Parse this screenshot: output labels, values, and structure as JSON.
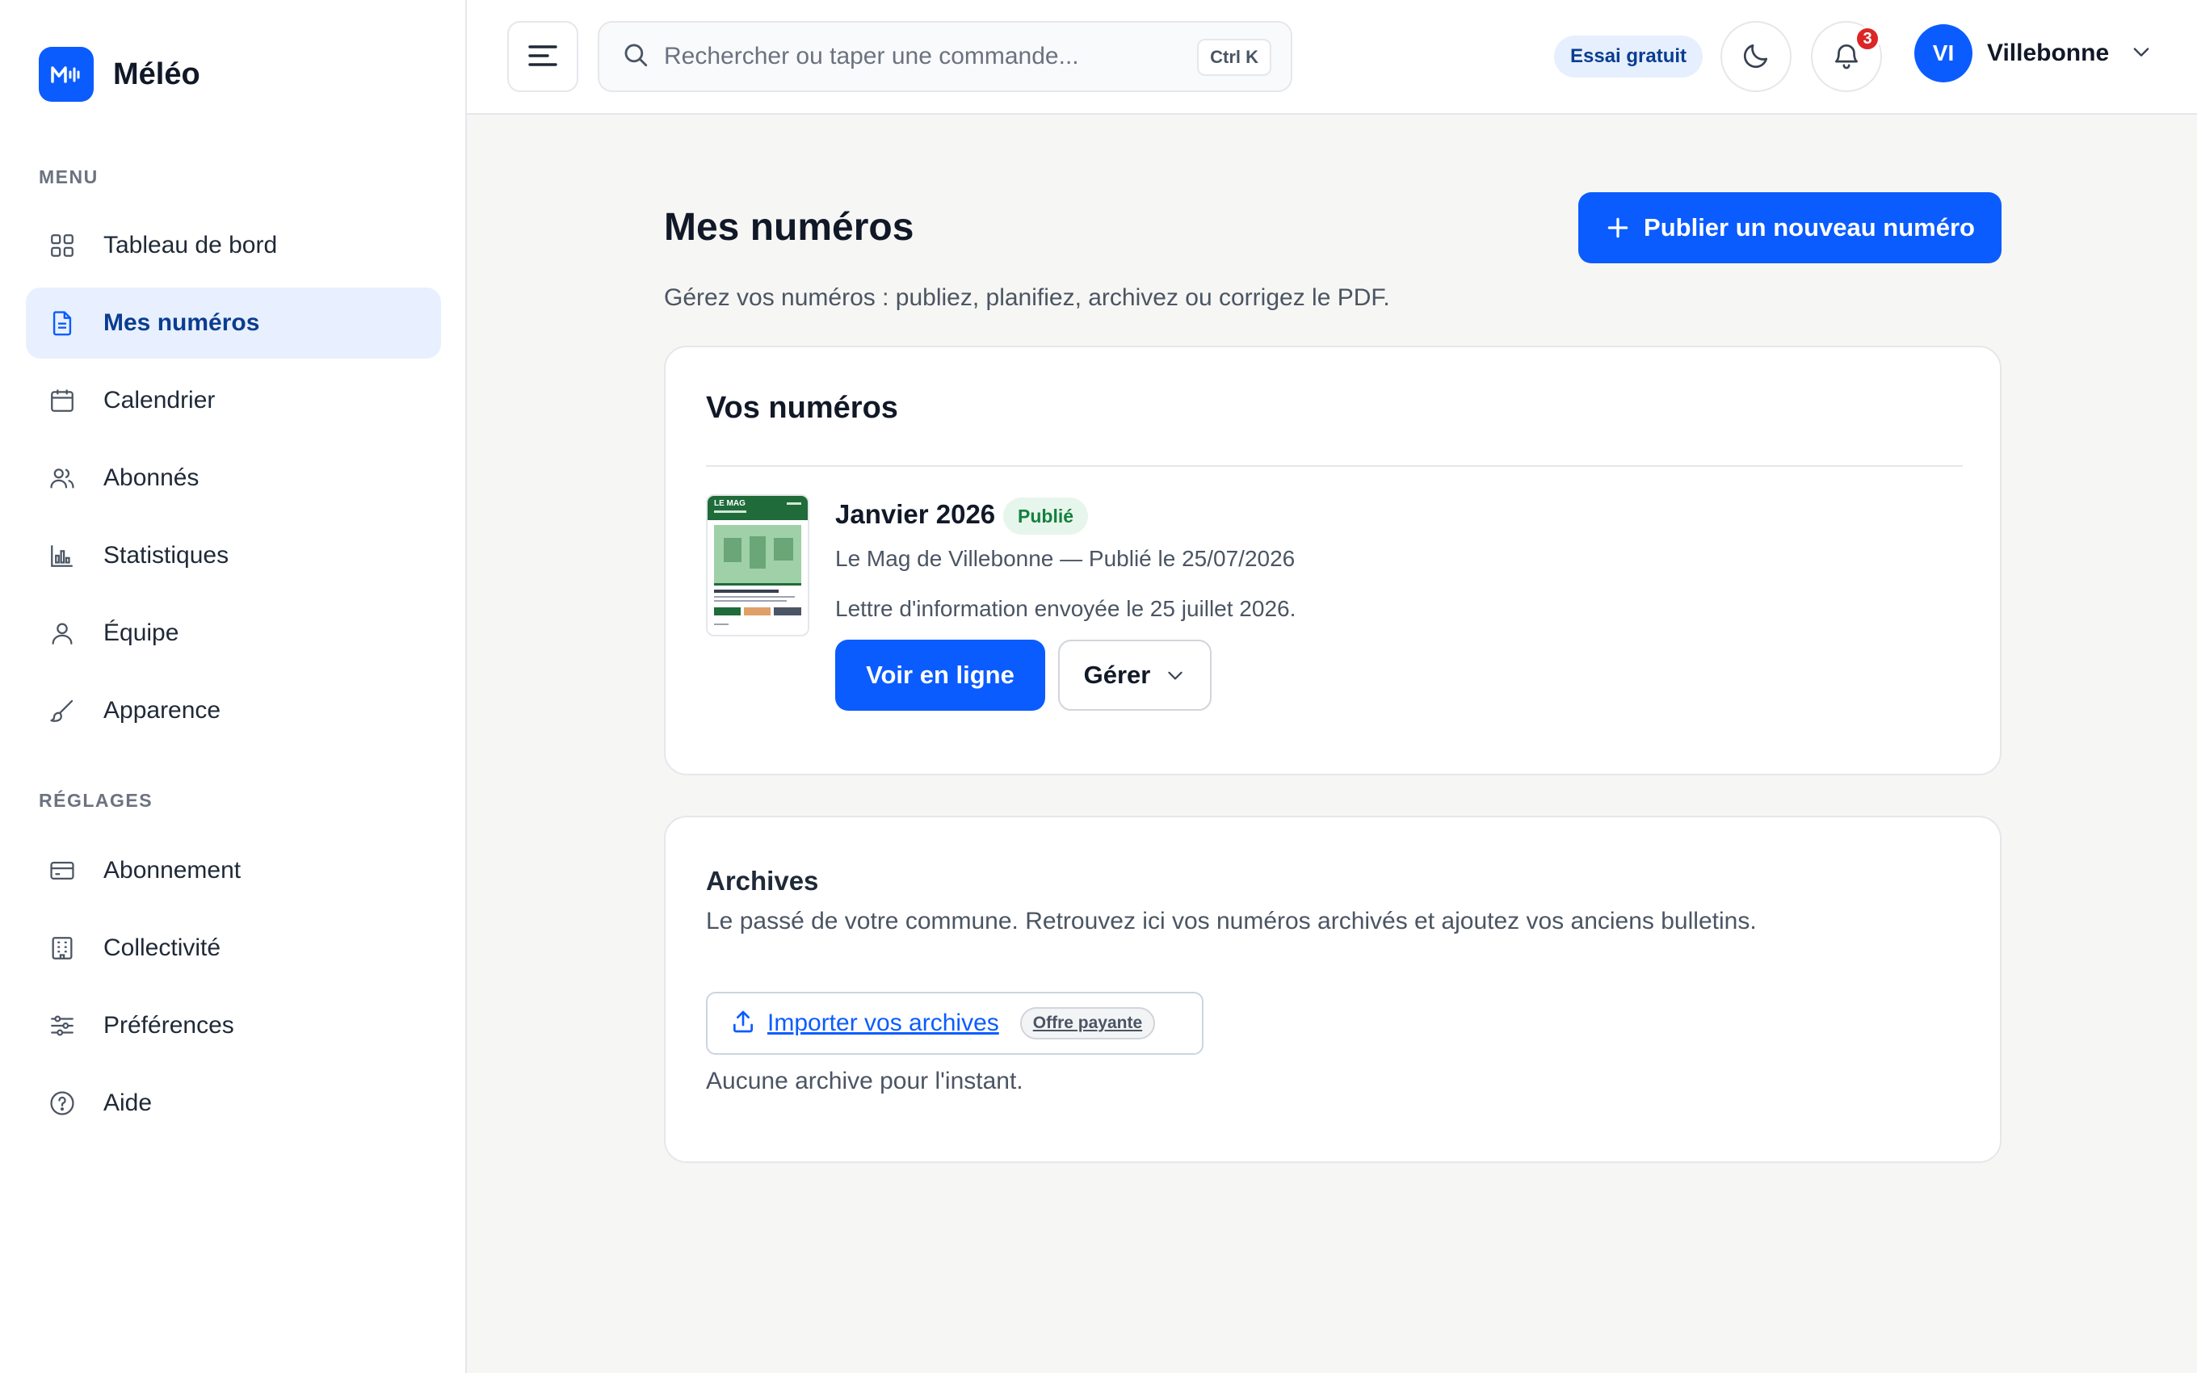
{
  "brand": {
    "name": "Méléo",
    "logo_text": "M"
  },
  "sidebar": {
    "menu_label": "MENU",
    "items": [
      {
        "label": "Tableau de bord",
        "icon": "grid-icon"
      },
      {
        "label": "Mes numéros",
        "icon": "document-icon",
        "active": true
      },
      {
        "label": "Calendrier",
        "icon": "calendar-icon"
      },
      {
        "label": "Abonnés",
        "icon": "users-icon"
      },
      {
        "label": "Statistiques",
        "icon": "bar-chart-icon"
      },
      {
        "label": "Équipe",
        "icon": "user-icon"
      },
      {
        "label": "Apparence",
        "icon": "brush-icon"
      }
    ],
    "settings_label": "RÉGLAGES",
    "settings_items": [
      {
        "label": "Abonnement",
        "icon": "credit-card-icon"
      },
      {
        "label": "Collectivité",
        "icon": "building-icon"
      },
      {
        "label": "Préférences",
        "icon": "sliders-icon"
      },
      {
        "label": "Aide",
        "icon": "help-circle-icon"
      }
    ]
  },
  "header": {
    "search_placeholder": "Rechercher ou taper une commande...",
    "search_shortcut": "Ctrl K",
    "trial_label": "Essai gratuit",
    "notification_count": "3",
    "user_initials": "VI",
    "user_name": "Villebonne"
  },
  "main": {
    "title": "Mes numéros",
    "subtitle": "Gérez vos numéros : publiez, planifiez, archivez ou corrigez le PDF.",
    "publish_button": "Publier un nouveau numéro",
    "issues_card": {
      "title": "Vos numéros",
      "issue": {
        "title": "Janvier 2026",
        "status": "Publié",
        "meta": "Le Mag de Villebonne — Publié le 25/07/2026",
        "note": "Lettre d'information envoyée le 25 juillet 2026.",
        "view_button": "Voir en ligne",
        "manage_button": "Gérer",
        "thumbnail_header": "LE MAG"
      }
    },
    "archives_card": {
      "title": "Archives",
      "description": "Le passé de votre commune. Retrouvez ici vos numéros archivés et ajoutez vos anciens bulletins.",
      "import_link": "Importer vos archives",
      "paid_badge": "Offre payante",
      "empty_text": "Aucune archive pour l'instant."
    }
  },
  "colors": {
    "accent": "#0b5cff",
    "active_nav_bg": "#e8f0ff",
    "success": "#15803d",
    "danger": "#dc2626",
    "page_bg": "#f6f6f4"
  }
}
